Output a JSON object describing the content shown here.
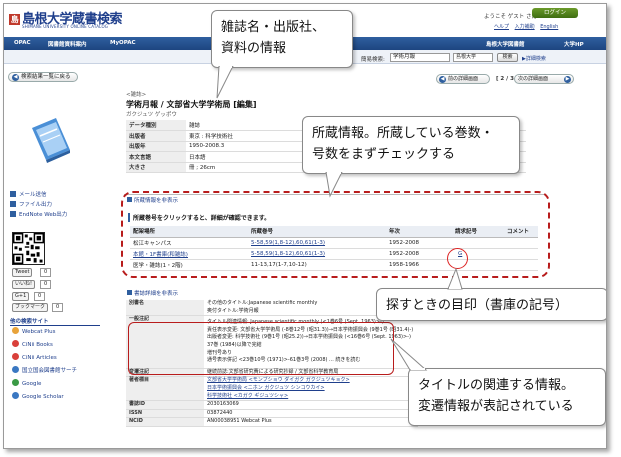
{
  "header": {
    "logo_text": "島根大学蔵書検索",
    "logo_sub": "SHIMANE UNIVERSITY ONLINE CATALOG",
    "greeting": "ようこそ ゲスト さん",
    "login_label": "ログイン",
    "help_links": [
      "ヘルプ",
      "入力補助",
      "English"
    ]
  },
  "nav": {
    "items": [
      "OPAC",
      "図書館資料案内",
      "MyOPAC"
    ],
    "right_items": [
      "島根大学図書館",
      "大学HP"
    ]
  },
  "search": {
    "label": "簡易検索:",
    "value": "学術月報",
    "select": "島根大学",
    "button": "検索",
    "detail_link": "▶詳細検索"
  },
  "result_nav": {
    "back": "検索結果一覧に戻る",
    "prev": "前の詳細画面",
    "page": "[ 2 / 3 ]",
    "next": "次の詳細画面"
  },
  "record": {
    "type": "<雑誌>",
    "title": "学術月報 / 文部省大学学術局 [編集]",
    "kana": "ガクジュツ ゲッポウ",
    "fields": [
      {
        "label": "データ種別",
        "value": "雑誌"
      },
      {
        "label": "出版者",
        "value": "東京 : 科学技術社"
      },
      {
        "label": "出版年",
        "value": "1950-2008.3"
      },
      {
        "label": "本文言語",
        "value": "日本語"
      },
      {
        "label": "大きさ",
        "value": "冊 ; 26cm"
      }
    ]
  },
  "left_links": [
    "メール送信",
    "ファイル出力",
    "EndNote Web出力"
  ],
  "sns": {
    "tweet": "Tweet",
    "tweet_count": "0",
    "like": "いいね!",
    "like_count": "0",
    "gplus": "G+1",
    "gplus_count": "0",
    "hatena": "ブックマーク",
    "hatena_count": "0"
  },
  "other_search": {
    "title": "他の検索サイト",
    "items": [
      {
        "label": "Webcat Plus",
        "color": "#e8a33a"
      },
      {
        "label": "CiNii Books",
        "color": "#d9403a"
      },
      {
        "label": "CiNii Articles",
        "color": "#d9403a"
      },
      {
        "label": "国立国会図書館サーチ",
        "color": "#3a78c2"
      },
      {
        "label": "Google",
        "color": "#3a9a45"
      },
      {
        "label": "Google Scholar",
        "color": "#3a78c2"
      }
    ]
  },
  "holdings": {
    "toggle": "所蔵情報を非表示",
    "note": "所蔵巻号をクリックすると、詳細が確認できます。",
    "headers": [
      "配架場所",
      "所蔵巻号",
      "年次",
      "請求記号",
      "コメント"
    ],
    "rows": [
      {
        "location": "松江キャンパス",
        "volumes": "5-58,59(1,8-12),60,61(1-3)",
        "years": "1952-2008",
        "call": "",
        "comment": ""
      },
      {
        "location": "本館・1F書庫(和雑誌)",
        "volumes": "5-58,59(1,8-12),60,61(1-3)",
        "years": "1952-2008",
        "call": "G",
        "comment": ""
      },
      {
        "location": "医学・雑誌(1・2階)",
        "volumes": "11-13,17(1-7,10-12)",
        "years": "1958-1966",
        "call": "",
        "comment": ""
      }
    ]
  },
  "bib": {
    "toggle": "書誌詳細を非表示",
    "rows": [
      {
        "label": "別書名",
        "lines": [
          "その他のタイトル:Japanese scientific monthly",
          "奥付タイトル:学術月報"
        ]
      },
      {
        "label": "一般注記",
        "lines": [
          "タイトル関連情報: Japanese scientific monthly (<1巻6号 (Sept. 1963)>-)",
          "責任表示変更: 文部省大学学術局 (-8巻12号 (昭31.3))→日本学術振興会 (9巻1号 (昭31.4)-)",
          "出版者変更: 科学技術社 (9巻1号 (昭25.2))→日本学術振興会 (<16巻6号 (Sept. 1963)>-)",
          "37巻 (1984)以降で完結",
          "増刊号あり",
          "通号表示併記 <23巻10号 (1971)>-61巻3号 (2008) ... 続きを読む"
        ]
      },
      {
        "label": "変遷注記",
        "lines": [
          "継続前誌:文部省研究費による研究抄録 / 文部省科学教育局"
        ]
      },
      {
        "label": "著者標目",
        "lines": [
          "文部省大学学術局 <モンブショウ ダイガク ガクジュツキョク>",
          "日本学術振興会 <ニホン ガクジュツ シンコウカイ>",
          "科学技術社 <カガク ギジュツシャ>"
        ]
      },
      {
        "label": "書誌ID",
        "lines": [
          "2030163069"
        ]
      },
      {
        "label": "ISSN",
        "lines": [
          "03872440"
        ]
      },
      {
        "label": "NCID",
        "lines": [
          "AN00038951 Webcat Plus"
        ]
      }
    ]
  },
  "callouts": {
    "c1": [
      "雑誌名・出版社、",
      "資料の情報"
    ],
    "c2": [
      "所蔵情報。所蔵している巻数・",
      "号数をまずチェックする"
    ],
    "c3": [
      "探すときの目印（書庫の記号）"
    ],
    "c4": [
      "タイトルの関連する情報。",
      "変遷情報が表記されている"
    ]
  }
}
